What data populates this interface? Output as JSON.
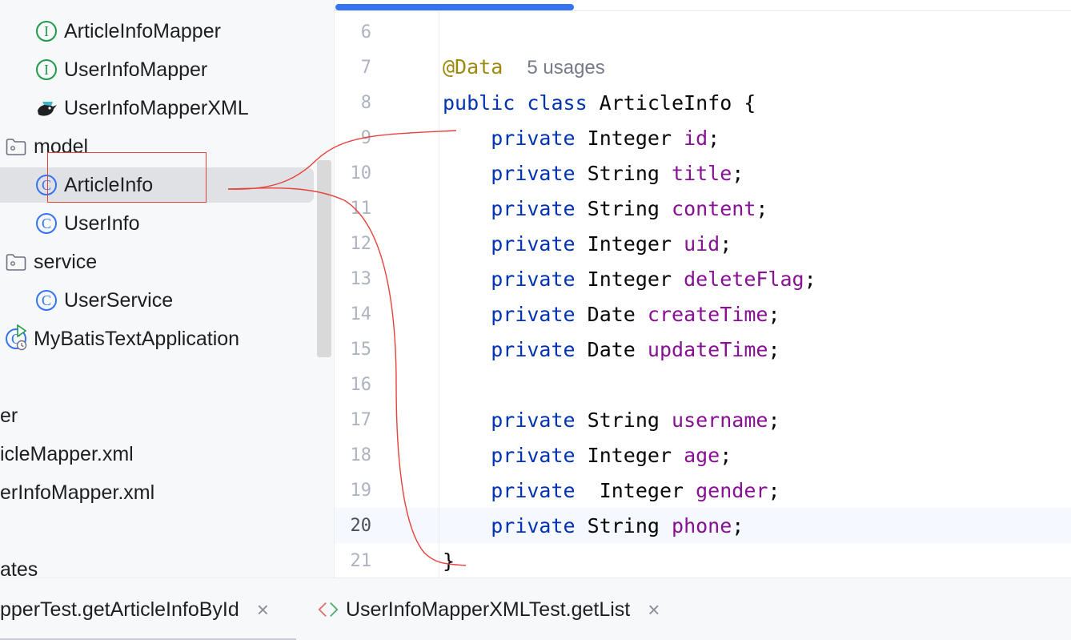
{
  "tree": {
    "items": [
      {
        "label": "ArticleInfoMapper",
        "icon": "interface-icon",
        "badge": "I"
      },
      {
        "label": "UserInfoMapper",
        "icon": "interface-icon",
        "badge": "I"
      },
      {
        "label": "UserInfoMapperXML",
        "icon": "mybatis-bird-icon"
      },
      {
        "label": "model",
        "icon": "package-folder-icon"
      },
      {
        "label": "ArticleInfo",
        "icon": "class-icon",
        "badge": "C",
        "selected": true
      },
      {
        "label": "UserInfo",
        "icon": "class-icon",
        "badge": "C"
      },
      {
        "label": "service",
        "icon": "package-folder-icon"
      },
      {
        "label": "UserService",
        "icon": "class-icon",
        "badge": "C"
      },
      {
        "label": "MyBatisTextApplication",
        "icon": "spring-boot-app-icon",
        "badge": "C"
      },
      {
        "label": "er"
      },
      {
        "label": "icleMapper.xml"
      },
      {
        "label": "erInfoMapper.xml"
      },
      {
        "label": "ates"
      }
    ]
  },
  "editor": {
    "lines": [
      {
        "n": "6"
      },
      {
        "n": "7",
        "annotation": "@Data",
        "hint": "5 usages"
      },
      {
        "n": "8",
        "kw": "public class",
        "rest": " ArticleInfo {"
      },
      {
        "n": "9",
        "kw": "private",
        "type": "Integer",
        "field": "id"
      },
      {
        "n": "10",
        "kw": "private",
        "type": "String",
        "field": "title"
      },
      {
        "n": "11",
        "kw": "private",
        "type": "String",
        "field": "content"
      },
      {
        "n": "12",
        "kw": "private",
        "type": "Integer",
        "field": "uid"
      },
      {
        "n": "13",
        "kw": "private",
        "type": "Integer",
        "field": "deleteFlag"
      },
      {
        "n": "14",
        "kw": "private",
        "type": "Date",
        "field": "createTime"
      },
      {
        "n": "15",
        "kw": "private",
        "type": "Date",
        "field": "updateTime"
      },
      {
        "n": "16"
      },
      {
        "n": "17",
        "kw": "private",
        "type": "String",
        "field": "username"
      },
      {
        "n": "18",
        "kw": "private",
        "type": "Integer",
        "field": "age"
      },
      {
        "n": "19",
        "kw": "private",
        "type": " Integer",
        "field": "gender"
      },
      {
        "n": "20",
        "kw": "private",
        "type": "String",
        "field": "phone",
        "current": true
      },
      {
        "n": "21",
        "rest": "}"
      }
    ]
  },
  "bottom_tabs": [
    {
      "label": "pperTest.getArticleInfoById",
      "close": "×"
    },
    {
      "label": "UserInfoMapperXMLTest.getList",
      "close": "×"
    }
  ],
  "colors": {
    "keyword": "#0033b3",
    "field": "#871094",
    "annotation": "#9e880d",
    "selection": "#dfe1e5",
    "accent": "#3574f0",
    "markup_red": "#e8413c"
  }
}
